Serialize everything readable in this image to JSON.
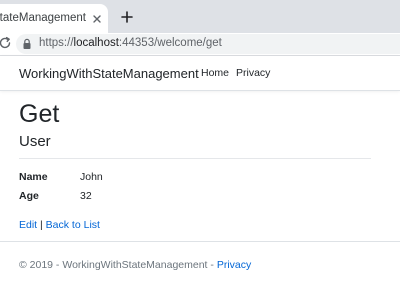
{
  "browser": {
    "tab_title": "WorkingWithStateManagement",
    "address": {
      "scheme": "https://",
      "host": "localhost",
      "rest": ":44353/welcome/get"
    },
    "icons": [
      "close-icon",
      "plus-icon",
      "reload-icon",
      "lock-icon"
    ]
  },
  "navbar": {
    "brand": "WorkingWithStateManagement",
    "links": [
      {
        "label": "Home"
      },
      {
        "label": "Privacy"
      }
    ]
  },
  "main": {
    "title": "Get",
    "subtitle": "User",
    "fields": [
      {
        "label": "Name",
        "value": "John"
      },
      {
        "label": "Age",
        "value": "32"
      }
    ],
    "actions": {
      "edit": "Edit",
      "separator": "|",
      "back": "Back to List"
    }
  },
  "footer": {
    "text": "© 2019 - WorkingWithStateManagement - ",
    "link": "Privacy"
  },
  "colors": {
    "link": "#0366d6",
    "text": "#212529",
    "muted": "#6c757d",
    "tabstrip": "#dee1e6",
    "omnibox": "#f1f3f4"
  }
}
